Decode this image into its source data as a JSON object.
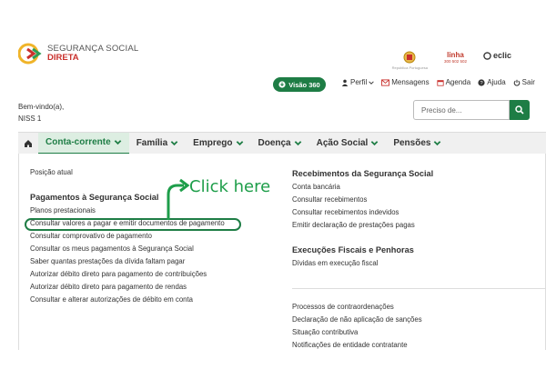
{
  "brand": {
    "line1": "SEGURANÇA SOCIAL",
    "line2": "DIRETA"
  },
  "partners": {
    "rep_caption": "República Portuguesa",
    "linha_name": "linha",
    "linha_number": "300 502 502",
    "eclic": "eclic"
  },
  "topbar": {
    "visao_label": "Visão 360",
    "links": [
      {
        "label": "Perfil",
        "icon": "user-icon"
      },
      {
        "label": "Mensagens",
        "icon": "envelope-icon"
      },
      {
        "label": "Agenda",
        "icon": "calendar-icon"
      },
      {
        "label": "Ajuda",
        "icon": "help-icon"
      },
      {
        "label": "Sair",
        "icon": "power-icon"
      }
    ]
  },
  "user": {
    "welcome": "Bem-vindo(a),",
    "niss": "NISS 1"
  },
  "search": {
    "placeholder": "Preciso de..."
  },
  "nav": {
    "items": [
      {
        "label": "Conta-corrente"
      },
      {
        "label": "Família"
      },
      {
        "label": "Emprego"
      },
      {
        "label": "Doença"
      },
      {
        "label": "Ação Social"
      },
      {
        "label": "Pensões"
      }
    ]
  },
  "menu": {
    "left": {
      "posicao": "Posição atual",
      "section_title": "Pagamentos à Segurança Social",
      "links": [
        "Planos prestacionais",
        "Consultar valores a pagar e emitir documentos de pagamento",
        "Consultar comprovativo de pagamento",
        "Consultar os meus pagamentos à Segurança Social",
        "Saber quantas prestações da dívida faltam pagar",
        "Autorizar débito direto para pagamento de contribuições",
        "Autorizar débito direto para pagamento de rendas",
        "Consultar e alterar autorizações de débito em conta"
      ]
    },
    "right": {
      "section1_title": "Recebimentos da Segurança Social",
      "section1_links": [
        "Conta bancária",
        "Consultar recebimentos",
        "Consultar recebimentos indevidos",
        "Emitir declaração de prestações pagas"
      ],
      "section2_title": "Execuções Fiscais e Penhoras",
      "section2_links": [
        "Dívidas em execução fiscal"
      ],
      "section3_links": [
        "Processos de contraordenações",
        "Declaração de não aplicação de sanções",
        "Situação contributiva",
        "Notificações de entidade contratante"
      ]
    }
  },
  "annotation": {
    "text": "Click here",
    "color": "#1e9e4a"
  },
  "colors": {
    "brand_green": "#1e7d45",
    "brand_red": "#c9302c"
  }
}
